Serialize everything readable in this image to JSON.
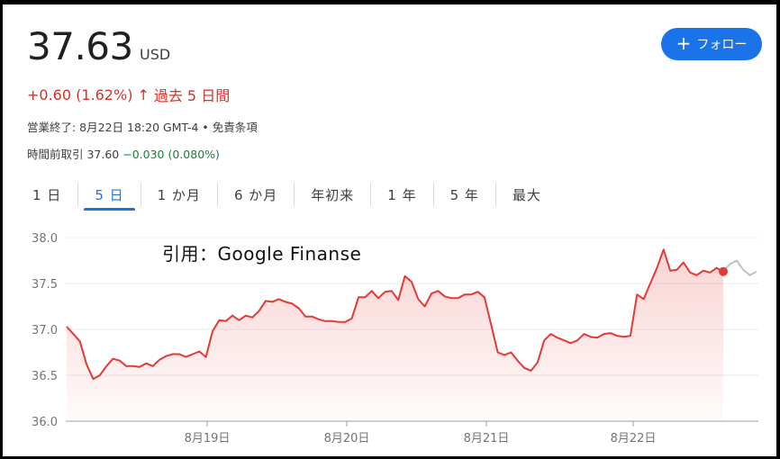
{
  "quote": {
    "price": "37.63",
    "currency": "USD",
    "change": "+0.60 (1.62%)",
    "change_arrow": "↑",
    "period": "過去 5 日間",
    "market_status": "営業終了: 8月22日 18:20 GMT-4 • 免責条項",
    "premarket_label": "時間前取引 37.60",
    "premarket_change": "−0.030 (0.080%)"
  },
  "follow_button": {
    "icon": "plus-icon",
    "label": "フォロー"
  },
  "tabs": [
    {
      "label": "1 日",
      "active": false
    },
    {
      "label": "5 日",
      "active": true
    },
    {
      "label": "1 か月",
      "active": false
    },
    {
      "label": "6 か月",
      "active": false
    },
    {
      "label": "年初来",
      "active": false
    },
    {
      "label": "1 年",
      "active": false
    },
    {
      "label": "5 年",
      "active": false
    },
    {
      "label": "最大",
      "active": false
    }
  ],
  "watermark": "引用：Google Finanse",
  "colors": {
    "accent": "#1a73e8",
    "down_line": "#e53935",
    "positive": "#d93025",
    "negative": "#188038"
  },
  "chart_data": {
    "type": "line",
    "ylim": [
      36.0,
      38.0
    ],
    "yticks": [
      "36.0",
      "36.5",
      "37.0",
      "37.5",
      "38.0"
    ],
    "xticks": [
      "8月19日",
      "8月20日",
      "8月21日",
      "8月22日"
    ],
    "grid": true,
    "series": [
      {
        "values": [
          37.03,
          36.95,
          36.87,
          36.62,
          36.46,
          36.5,
          36.6,
          36.68,
          36.66,
          36.6,
          36.6,
          36.59,
          36.63,
          36.6,
          36.67,
          36.71,
          36.73,
          36.73,
          36.7,
          36.73,
          36.76,
          36.7,
          36.98,
          37.1,
          37.09,
          37.15,
          37.1,
          37.15,
          37.13,
          37.2,
          37.31,
          37.3,
          37.33,
          37.3,
          37.28,
          37.23,
          37.14,
          37.14,
          37.11,
          37.09,
          37.09,
          37.08,
          37.08,
          37.12,
          37.35,
          37.35,
          37.42,
          37.34,
          37.41,
          37.42,
          37.32,
          37.58,
          37.52,
          37.33,
          37.25,
          37.39,
          37.42,
          37.36,
          37.34,
          37.34,
          37.38,
          37.38,
          37.41,
          37.35,
          37.05,
          36.75,
          36.72,
          36.75,
          36.66,
          36.58,
          36.55,
          36.64,
          36.88,
          36.95,
          36.91,
          36.88,
          36.85,
          36.88,
          36.95,
          36.92,
          36.91,
          36.95,
          36.96,
          36.93,
          36.92,
          36.93,
          37.38,
          37.33,
          37.5,
          37.67,
          37.87,
          37.64,
          37.65,
          37.73,
          37.62,
          37.59,
          37.64,
          37.62,
          37.67,
          37.63
        ],
        "after_hours": [
          37.63,
          37.71,
          37.75,
          37.65,
          37.59,
          37.63
        ]
      }
    ]
  }
}
